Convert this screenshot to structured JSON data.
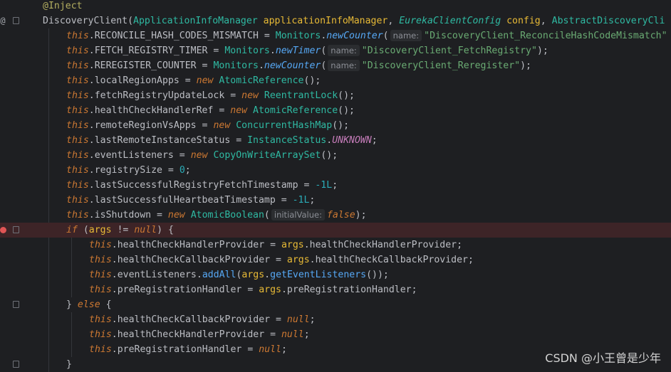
{
  "editor": {
    "breakpoint_color": "#e05555",
    "lines": [
      {
        "tokens": [
          {
            "c": "ann",
            "t": "@Inject"
          }
        ]
      },
      {
        "tokens": [
          {
            "c": "plain",
            "t": "DiscoveryClient"
          },
          {
            "c": "plain",
            "t": "("
          },
          {
            "c": "cls",
            "t": "ApplicationInfoManager"
          },
          {
            "c": "plain",
            "t": " "
          },
          {
            "c": "param",
            "t": "applicationInfoManager"
          },
          {
            "c": "plain",
            "t": ", "
          },
          {
            "c": "cls ital",
            "t": "EurekaClientConfig"
          },
          {
            "c": "plain",
            "t": " "
          },
          {
            "c": "param",
            "t": "config"
          },
          {
            "c": "plain",
            "t": ", "
          },
          {
            "c": "cls",
            "t": "AbstractDiscoveryCli"
          }
        ]
      },
      {
        "tokens": [
          {
            "c": "this",
            "t": "this"
          },
          {
            "c": "plain",
            "t": ".RECONCILE_HASH_CODES_MISMATCH = "
          },
          {
            "c": "cls",
            "t": "Monitors"
          },
          {
            "c": "plain",
            "t": "."
          },
          {
            "c": "fni",
            "t": "newCounter"
          },
          {
            "c": "plain",
            "t": "("
          },
          {
            "c": "hint",
            "t": "name:"
          },
          {
            "c": "str",
            "t": "\"DiscoveryClient_ReconcileHashCodeMismatch\""
          }
        ]
      },
      {
        "tokens": [
          {
            "c": "this",
            "t": "this"
          },
          {
            "c": "plain",
            "t": ".FETCH_REGISTRY_TIMER = "
          },
          {
            "c": "cls",
            "t": "Monitors"
          },
          {
            "c": "plain",
            "t": "."
          },
          {
            "c": "fni",
            "t": "newTimer"
          },
          {
            "c": "plain",
            "t": "("
          },
          {
            "c": "hint",
            "t": "name:"
          },
          {
            "c": "str",
            "t": "\"DiscoveryClient_FetchRegistry\""
          },
          {
            "c": "plain",
            "t": ");"
          }
        ]
      },
      {
        "tokens": [
          {
            "c": "this",
            "t": "this"
          },
          {
            "c": "plain",
            "t": ".REREGISTER_COUNTER = "
          },
          {
            "c": "cls",
            "t": "Monitors"
          },
          {
            "c": "plain",
            "t": "."
          },
          {
            "c": "fni",
            "t": "newCounter"
          },
          {
            "c": "plain",
            "t": "("
          },
          {
            "c": "hint",
            "t": "name:"
          },
          {
            "c": "str",
            "t": "\"DiscoveryClient_Reregister\""
          },
          {
            "c": "plain",
            "t": ");"
          }
        ]
      },
      {
        "tokens": [
          {
            "c": "this",
            "t": "this"
          },
          {
            "c": "plain",
            "t": ".localRegionApps = "
          },
          {
            "c": "kw ital",
            "t": "new"
          },
          {
            "c": "plain",
            "t": " "
          },
          {
            "c": "cls",
            "t": "AtomicReference"
          },
          {
            "c": "plain",
            "t": "();"
          }
        ]
      },
      {
        "tokens": [
          {
            "c": "this",
            "t": "this"
          },
          {
            "c": "plain",
            "t": ".fetchRegistryUpdateLock = "
          },
          {
            "c": "kw ital",
            "t": "new"
          },
          {
            "c": "plain",
            "t": " "
          },
          {
            "c": "cls",
            "t": "ReentrantLock"
          },
          {
            "c": "plain",
            "t": "();"
          }
        ]
      },
      {
        "tokens": [
          {
            "c": "this",
            "t": "this"
          },
          {
            "c": "plain",
            "t": ".healthCheckHandlerRef = "
          },
          {
            "c": "kw ital",
            "t": "new"
          },
          {
            "c": "plain",
            "t": " "
          },
          {
            "c": "cls",
            "t": "AtomicReference"
          },
          {
            "c": "plain",
            "t": "();"
          }
        ]
      },
      {
        "tokens": [
          {
            "c": "this",
            "t": "this"
          },
          {
            "c": "plain",
            "t": ".remoteRegionVsApps = "
          },
          {
            "c": "kw ital",
            "t": "new"
          },
          {
            "c": "plain",
            "t": " "
          },
          {
            "c": "cls",
            "t": "ConcurrentHashMap"
          },
          {
            "c": "plain",
            "t": "();"
          }
        ]
      },
      {
        "tokens": [
          {
            "c": "this",
            "t": "this"
          },
          {
            "c": "plain",
            "t": ".lastRemoteInstanceStatus = "
          },
          {
            "c": "cls",
            "t": "InstanceStatus"
          },
          {
            "c": "plain",
            "t": "."
          },
          {
            "c": "const",
            "t": "UNKNOWN"
          },
          {
            "c": "plain",
            "t": ";"
          }
        ]
      },
      {
        "tokens": [
          {
            "c": "this",
            "t": "this"
          },
          {
            "c": "plain",
            "t": ".eventListeners = "
          },
          {
            "c": "kw ital",
            "t": "new"
          },
          {
            "c": "plain",
            "t": " "
          },
          {
            "c": "cls",
            "t": "CopyOnWriteArraySet"
          },
          {
            "c": "plain",
            "t": "();"
          }
        ]
      },
      {
        "tokens": [
          {
            "c": "this",
            "t": "this"
          },
          {
            "c": "plain",
            "t": ".registrySize = "
          },
          {
            "c": "num",
            "t": "0"
          },
          {
            "c": "plain",
            "t": ";"
          }
        ]
      },
      {
        "tokens": [
          {
            "c": "this",
            "t": "this"
          },
          {
            "c": "plain",
            "t": ".lastSuccessfulRegistryFetchTimestamp = "
          },
          {
            "c": "num",
            "t": "-1L"
          },
          {
            "c": "plain",
            "t": ";"
          }
        ]
      },
      {
        "tokens": [
          {
            "c": "this",
            "t": "this"
          },
          {
            "c": "plain",
            "t": ".lastSuccessfulHeartbeatTimestamp = "
          },
          {
            "c": "num",
            "t": "-1L"
          },
          {
            "c": "plain",
            "t": ";"
          }
        ]
      },
      {
        "tokens": [
          {
            "c": "this",
            "t": "this"
          },
          {
            "c": "plain",
            "t": ".isShutdown = "
          },
          {
            "c": "kw ital",
            "t": "new"
          },
          {
            "c": "plain",
            "t": " "
          },
          {
            "c": "cls",
            "t": "AtomicBoolean"
          },
          {
            "c": "plain",
            "t": "("
          },
          {
            "c": "hint",
            "t": "initialValue:"
          },
          {
            "c": "kw ital",
            "t": "false"
          },
          {
            "c": "plain",
            "t": ");"
          }
        ]
      },
      {
        "tokens": [
          {
            "c": "kw ital",
            "t": "if"
          },
          {
            "c": "plain",
            "t": " ("
          },
          {
            "c": "argv",
            "t": "args"
          },
          {
            "c": "plain",
            "t": " != "
          },
          {
            "c": "kw ital",
            "t": "null"
          },
          {
            "c": "plain",
            "t": ") {"
          }
        ]
      },
      {
        "tokens": [
          {
            "c": "this",
            "t": "this"
          },
          {
            "c": "plain",
            "t": ".healthCheckHandlerProvider = "
          },
          {
            "c": "argv",
            "t": "args"
          },
          {
            "c": "plain",
            "t": ".healthCheckHandlerProvider;"
          }
        ]
      },
      {
        "tokens": [
          {
            "c": "this",
            "t": "this"
          },
          {
            "c": "plain",
            "t": ".healthCheckCallbackProvider = "
          },
          {
            "c": "argv",
            "t": "args"
          },
          {
            "c": "plain",
            "t": ".healthCheckCallbackProvider;"
          }
        ]
      },
      {
        "tokens": [
          {
            "c": "this",
            "t": "this"
          },
          {
            "c": "plain",
            "t": ".eventListeners."
          },
          {
            "c": "fn",
            "t": "addAll"
          },
          {
            "c": "plain",
            "t": "("
          },
          {
            "c": "argv",
            "t": "args"
          },
          {
            "c": "plain",
            "t": "."
          },
          {
            "c": "fn",
            "t": "getEventListeners"
          },
          {
            "c": "plain",
            "t": "());"
          }
        ]
      },
      {
        "tokens": [
          {
            "c": "this",
            "t": "this"
          },
          {
            "c": "plain",
            "t": ".preRegistrationHandler = "
          },
          {
            "c": "argv",
            "t": "args"
          },
          {
            "c": "plain",
            "t": ".preRegistrationHandler;"
          }
        ]
      },
      {
        "tokens": [
          {
            "c": "plain",
            "t": "} "
          },
          {
            "c": "kw ital",
            "t": "else"
          },
          {
            "c": "plain",
            "t": " {"
          }
        ]
      },
      {
        "tokens": [
          {
            "c": "this",
            "t": "this"
          },
          {
            "c": "plain",
            "t": ".healthCheckCallbackProvider = "
          },
          {
            "c": "kw ital",
            "t": "null"
          },
          {
            "c": "plain",
            "t": ";"
          }
        ]
      },
      {
        "tokens": [
          {
            "c": "this",
            "t": "this"
          },
          {
            "c": "plain",
            "t": ".healthCheckHandlerProvider = "
          },
          {
            "c": "kw ital",
            "t": "null"
          },
          {
            "c": "plain",
            "t": ";"
          }
        ]
      },
      {
        "tokens": [
          {
            "c": "this",
            "t": "this"
          },
          {
            "c": "plain",
            "t": ".preRegistrationHandler = "
          },
          {
            "c": "kw ital",
            "t": "null"
          },
          {
            "c": "plain",
            "t": ";"
          }
        ]
      },
      {
        "tokens": [
          {
            "c": "plain",
            "t": "}"
          }
        ]
      }
    ]
  },
  "watermark": "CSDN @小王曾是少年"
}
